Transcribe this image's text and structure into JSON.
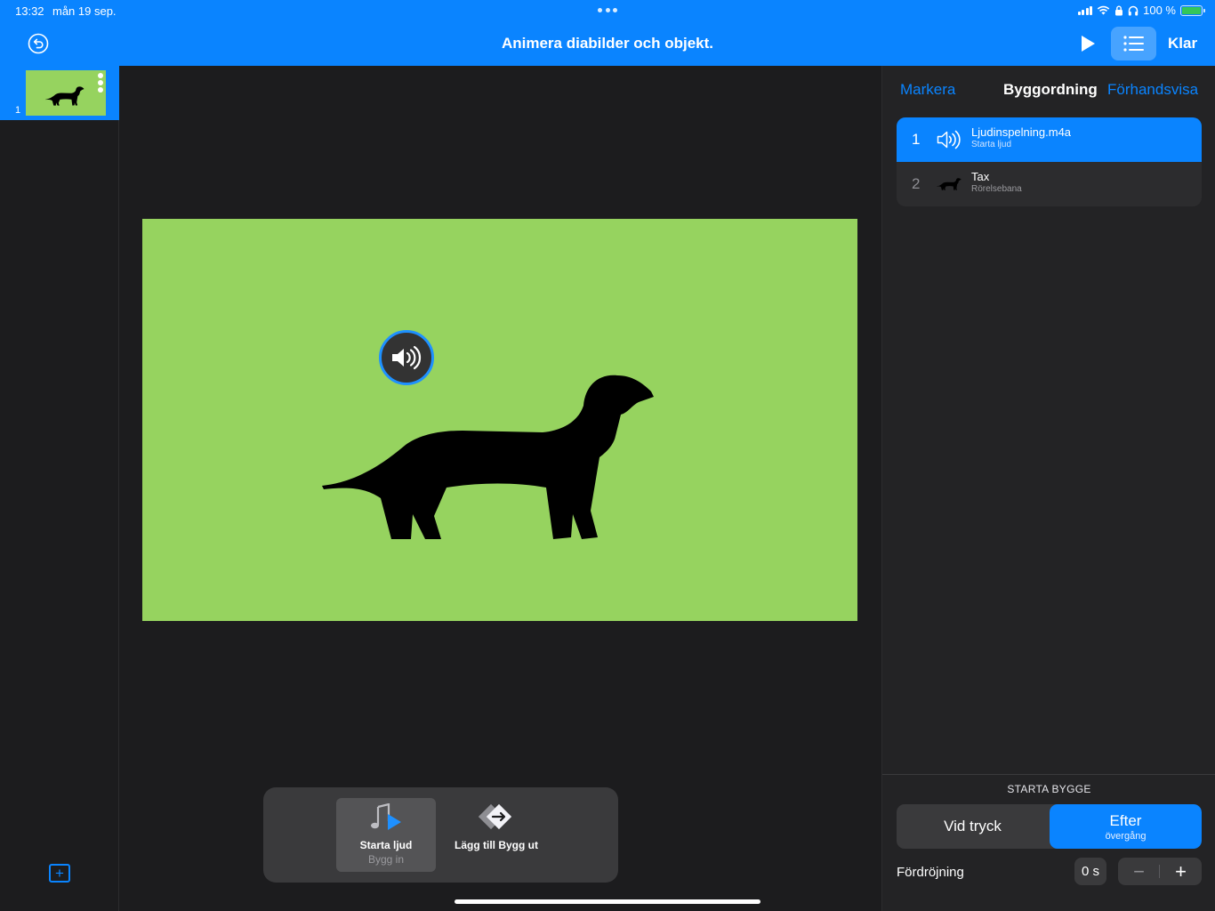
{
  "status_bar": {
    "time": "13:32",
    "date": "mån 19 sep.",
    "battery": "100 %",
    "battery_level": 1.0,
    "icons": [
      "cellular-signal-icon",
      "wifi-icon",
      "lock-rotation-icon",
      "headphones-icon",
      "battery-charging-icon"
    ]
  },
  "header": {
    "title": "Animera diabilder och objekt.",
    "done_label": "Klar",
    "icons": [
      "undo-icon",
      "play-icon",
      "list-icon"
    ]
  },
  "navigator": {
    "slides": [
      {
        "number": "1"
      }
    ],
    "icons": [
      "add-slide-icon"
    ]
  },
  "toolbar": {
    "items": [
      {
        "label": "Starta ljud",
        "sublabel": "Bygg in",
        "icon": "music-play-icon",
        "selected": true
      },
      {
        "label": "Lägg till Bygg ut",
        "sublabel": "",
        "icon": "build-out-arrow-icon",
        "selected": false
      }
    ]
  },
  "inspector": {
    "tabs": [
      {
        "label": "Markera",
        "active": false
      },
      {
        "label": "Byggordning",
        "active": true
      },
      {
        "label": "Förhandsvisa",
        "active": false
      }
    ],
    "builds": [
      {
        "number": "1",
        "name": "Ljudinspelning.m4a",
        "effect": "Starta ljud",
        "icon": "speaker-icon",
        "selected": true
      },
      {
        "number": "2",
        "name": "Tax",
        "effect": "Rörelsebana",
        "icon": "dog-icon",
        "selected": false
      }
    ],
    "start_build_label": "STARTA BYGGE",
    "start_options": {
      "on_tap": "Vid tryck",
      "after_main": "Efter",
      "after_sub": "övergång",
      "selected": "after"
    },
    "delay_label": "Fördröjning",
    "delay_value": "0 s"
  },
  "colors": {
    "accent": "#0a84ff",
    "slide_background": "#96d35f",
    "app_background": "#1c1c1e"
  }
}
